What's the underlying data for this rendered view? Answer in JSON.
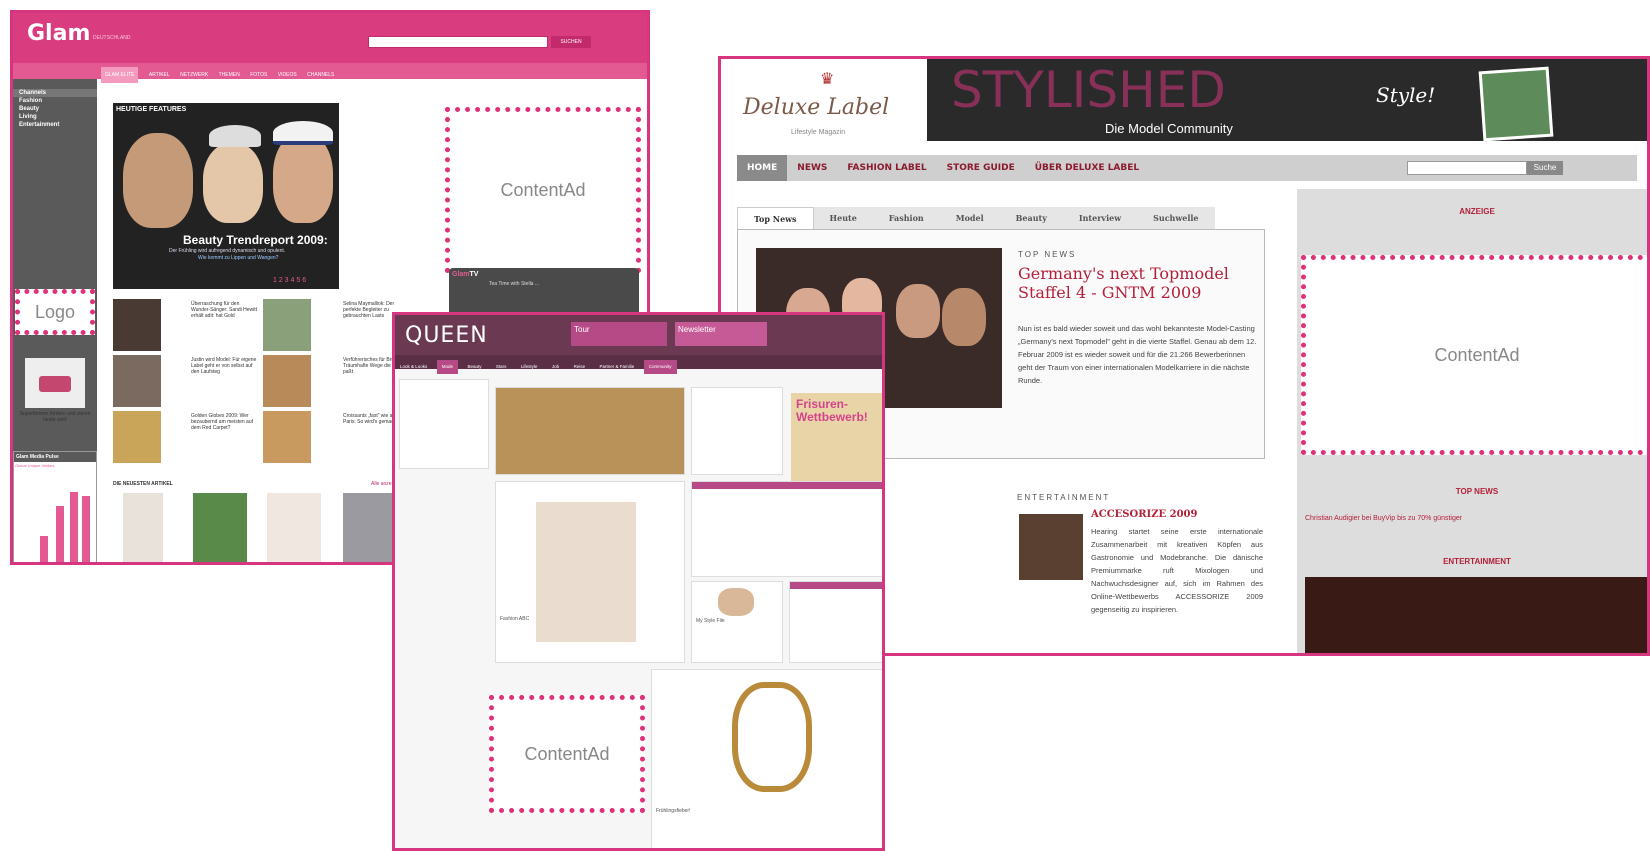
{
  "glam": {
    "logo": "Glam",
    "logo_sub": "DEUTSCHLAND",
    "search_button": "SUCHEN",
    "nav": [
      "GLAM ELITE",
      "ARTIKEL",
      "NETZWERK",
      "THEMEN",
      "FOTOS",
      "VIDEOS",
      "CHANNELS"
    ],
    "sidebar": [
      "Channels",
      "Fashion",
      "Beauty",
      "Living",
      "Entertainment"
    ],
    "feature_label": "HEUTIGE FEATURES",
    "feature_title": "Beauty Trendreport 2009:",
    "feature_sub": "Der Frühling wird aufregend dynamisch und opulent.",
    "feature_sub2": "Wie kommt zu Lippen und Wangen?",
    "feature_pages": "1 2 3 4 5 6",
    "articles": [
      "Überraschung für den Wunder-Sänger: Sandi Hewitt erhält adit: hat Gold",
      "Justin wird Model: Für eigene Label geht er von selbst auf den Laufsteg",
      "Golden Globes 2009: Wer bezaubernd am meisten auf dem Red Carpet?",
      "Selina Maymalliok: Der perfekte Begleiter zu gebrauchten Lasts",
      "Verführerisches für Brunker: Träumhafte Wege die immer paßt",
      "Croissants „fast” wie aus Paris: So wird's gemacht!"
    ],
    "newest_label": "DIE NEUESTEN ARTIKEL",
    "all_link": "Alle anzei",
    "tv_label_a": "Glam",
    "tv_label_b": "TV",
    "tv_item": "Tea Time with Stella ...",
    "logo_ad": "Logo",
    "pillow_text": "Superformen fördern und zieren heute weil!",
    "pulse_title": "Glam Media Pulse",
    "pulse_sub": "Global Unique Visitors",
    "content_ad": "ContentAd"
  },
  "stylished": {
    "brand": "Deluxe Label",
    "brand_sub": "Lifestyle Magazin",
    "title": "STYLISHED",
    "subtitle": "Die Model Community",
    "style_tag": "Style!",
    "nav": [
      "HOME",
      "NEWS",
      "FASHION LABEL",
      "STORE GUIDE",
      "ÜBER DELUXE LABEL"
    ],
    "search_button": "Suche",
    "tabs": [
      "Top News",
      "Heute",
      "Fashion",
      "Model",
      "Beauty",
      "Interview",
      "Suchwelle"
    ],
    "top_label": "TOP NEWS",
    "headline": "Germany's next Topmodel Staffel 4 - GNTM 2009",
    "teaser": "Nun ist es bald wieder soweit und das wohl bekannteste Model-Casting „Germany's next Topmodel” geht in die vierte Staffel. Genau ab dem 12. Februar 2009 ist es wieder soweit und für die 21.266 Bewerberinnen geht der Traum von einer internationalen Modelkarriere in die nächste Runde.",
    "ent_label": "ENTERTAINMENT",
    "ent_title": "ACCESORIZE 2009",
    "ent_text": "Hearing startet seine erste internationale Zusammenarbeit mit kreativen Köpfen aus Gastronomie und Modebranche. Die dänische Premiummarke ruft Mixologen und Nachwuchsdesigner auf, sich im Rahmen des Online-Wettbewerbs ACCESSORIZE 2009 gegenseitig zu inspirieren.",
    "anzeige": "ANZEIGE",
    "top_news": "TOP NEWS",
    "top_news_text": "Christian Audigier bei BuyVip bis zu 70% günstiger",
    "entertainment": "ENTERTAINMENT",
    "content_ad": "ContentAd"
  },
  "queen": {
    "logo": "QUEEN",
    "tour": "Tour",
    "newsletter": "Newsletter",
    "nav": [
      "Look & Looks",
      "Mode",
      "Beauty",
      "Stars",
      "Lifestyle",
      "Job",
      "Reise",
      "Partner & Familie",
      "Community"
    ],
    "fri": "Frisuren-Wettbewerb!",
    "section": "Fashion ABC",
    "section2": "My Style File",
    "section3": "Frühlingsfieber!",
    "content_ad": "ContentAd"
  }
}
